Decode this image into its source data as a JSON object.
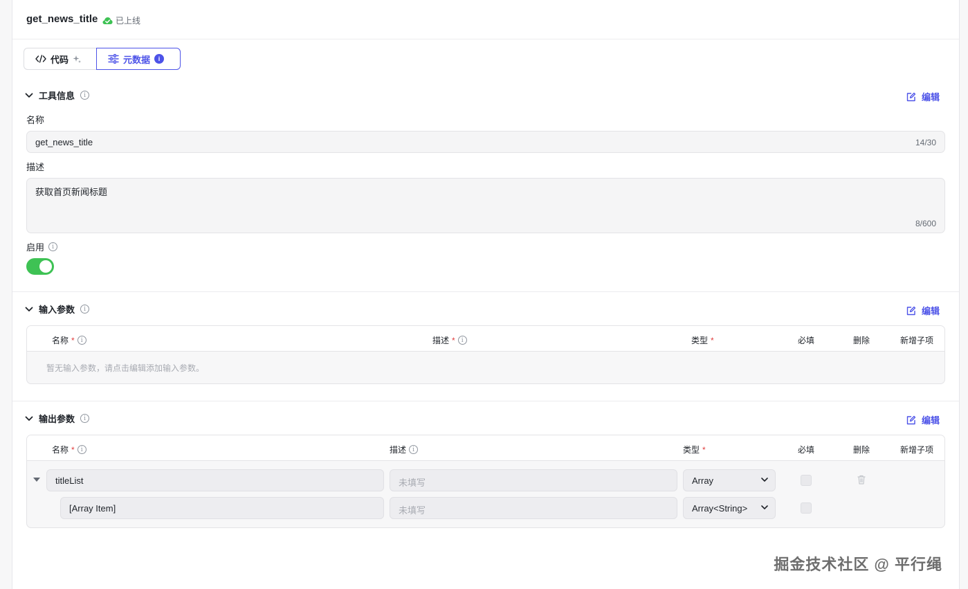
{
  "header": {
    "title": "get_news_title",
    "status_label": "已上线",
    "status_color": "#3ec254"
  },
  "tabs": [
    {
      "label": "代码",
      "icon": "code-icon",
      "active": false
    },
    {
      "label": "元数据",
      "icon": "sliders-icon",
      "active": true,
      "badge": "i"
    }
  ],
  "tool_info": {
    "section_title": "工具信息",
    "edit_label": "编辑",
    "name_label": "名称",
    "name_value": "get_news_title",
    "name_count": "14/30",
    "desc_label": "描述",
    "desc_value": "获取首页新闻标题",
    "desc_count": "8/600",
    "enable_label": "启用",
    "enabled": true
  },
  "input_params": {
    "section_title": "输入参数",
    "edit_label": "编辑",
    "columns": {
      "name": "名称",
      "desc": "描述",
      "type": "类型",
      "required": "必填",
      "delete": "删除",
      "add_child": "新增子项"
    },
    "required_mark": "*",
    "empty_text": "暂无输入参数，请点击编辑添加输入参数。"
  },
  "output_params": {
    "section_title": "输出参数",
    "edit_label": "编辑",
    "columns": {
      "name": "名称",
      "desc": "描述",
      "type": "类型",
      "required": "必填",
      "delete": "删除",
      "add_child": "新增子项"
    },
    "required_mark": "*",
    "rows": [
      {
        "name": "titleList",
        "desc_placeholder": "未填写",
        "type": "Array"
      },
      {
        "name": "[Array Item]",
        "desc_placeholder": "未填写",
        "type": "Array<String>"
      }
    ]
  },
  "watermark": "掘金技术社区 @ 平行绳",
  "accent_color": "#4d53e8"
}
